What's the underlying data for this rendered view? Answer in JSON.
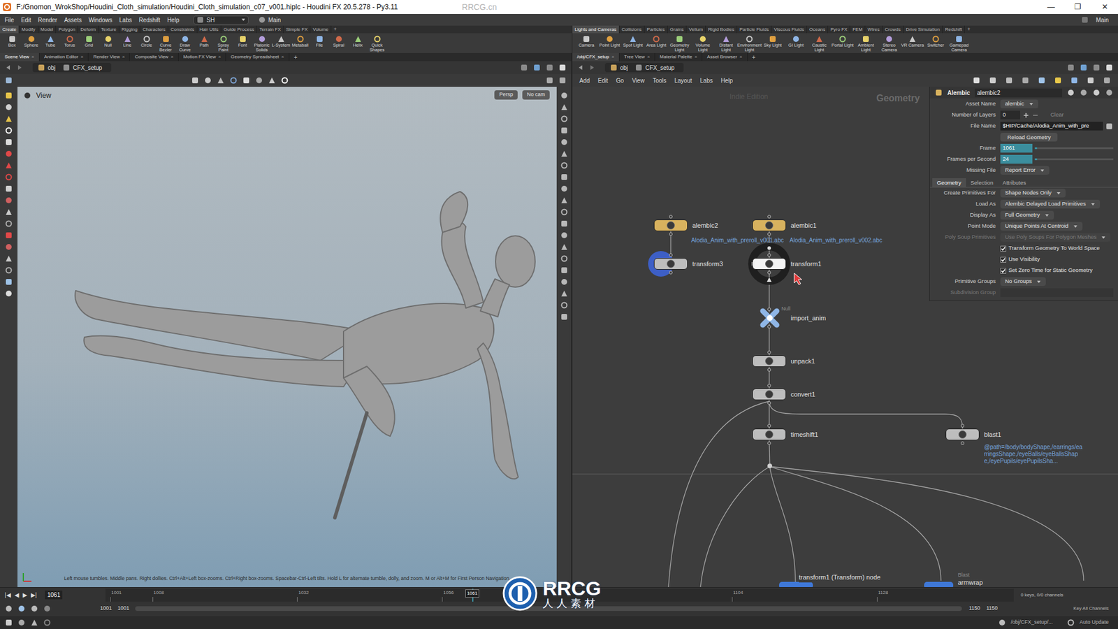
{
  "window": {
    "title": "F:/Gnomon_WrokShop/Houdini_Cloth_simulation/Houdini_Cloth_simulation_c07_v001.hiplc - Houdini FX 20.5.278 - Py3.11",
    "watermark": "RRCG.cn",
    "controls": [
      "—",
      "❐",
      "✕"
    ]
  },
  "menu": [
    "File",
    "Edit",
    "Render",
    "Assets",
    "Windows",
    "Labs",
    "Redshift",
    "Help"
  ],
  "desktop": {
    "value": "SH",
    "main": "Main",
    "main_right": "Main"
  },
  "ui": {
    "close": "×",
    "add": "+"
  },
  "shelf": {
    "tabs_left": [
      {
        "label": "Create",
        "selected": true
      },
      {
        "label": "Modify",
        "selected": false
      },
      {
        "label": "Model",
        "selected": false
      },
      {
        "label": "Polygon",
        "selected": false
      },
      {
        "label": "Deform",
        "selected": false
      },
      {
        "label": "Texture",
        "selected": false
      },
      {
        "label": "Rigging",
        "selected": false
      },
      {
        "label": "Characters",
        "selected": false
      },
      {
        "label": "Constraints",
        "selected": false
      },
      {
        "label": "Hair Utils",
        "selected": false
      },
      {
        "label": "Guide Process",
        "selected": false
      },
      {
        "label": "Terrain FX",
        "selected": false
      },
      {
        "label": "Simple FX",
        "selected": false
      },
      {
        "label": "Volume",
        "selected": false
      }
    ],
    "tabs_right": [
      {
        "label": "Lights and Cameras",
        "selected": true
      },
      {
        "label": "Collisions",
        "selected": false
      },
      {
        "label": "Particles",
        "selected": false
      },
      {
        "label": "Grains",
        "selected": false
      },
      {
        "label": "Vellum",
        "selected": false
      },
      {
        "label": "Rigid Bodies",
        "selected": false
      },
      {
        "label": "Particle Fluids",
        "selected": false
      },
      {
        "label": "Viscous Fluids",
        "selected": false
      },
      {
        "label": "Oceans",
        "selected": false
      },
      {
        "label": "Pyro FX",
        "selected": false
      },
      {
        "label": "FEM",
        "selected": false
      },
      {
        "label": "Wires",
        "selected": false
      },
      {
        "label": "Crowds",
        "selected": false
      },
      {
        "label": "Drive Simulation",
        "selected": false
      },
      {
        "label": "Redshift",
        "selected": false
      }
    ],
    "tools_left": [
      "Box",
      "Sphere",
      "Tube",
      "Torus",
      "Grid",
      "Null",
      "Line",
      "Circle",
      "Curve Bezier",
      "Draw Curve",
      "Path",
      "Spray Paint",
      "Font",
      "Platonic Solids",
      "L-System",
      "Metaball",
      "File",
      "Spiral",
      "Helix",
      "Quick Shapes"
    ],
    "tools_right": [
      "Camera",
      "Point Light",
      "Spot Light",
      "Area Light",
      "Geometry Light",
      "Volume Light",
      "Distant Light",
      "Environment Light",
      "Sky Light",
      "GI Light",
      "Caustic Light",
      "Portal Light",
      "Ambient Light",
      "Stereo Camera",
      "VR Camera",
      "Switcher",
      "Gamepad Camera"
    ]
  },
  "panes": {
    "left_tabs": [
      {
        "label": "Scene View",
        "selected": true
      },
      {
        "label": "Animation Editor",
        "selected": false
      },
      {
        "label": "Render View",
        "selected": false
      },
      {
        "label": "Composite View",
        "selected": false
      },
      {
        "label": "Motion FX View",
        "selected": false
      },
      {
        "label": "Geometry Spreadsheet",
        "selected": false
      }
    ],
    "right_tabs": [
      {
        "label": "/obj/CFX_setup",
        "selected": true
      },
      {
        "label": "Tree View",
        "selected": false
      },
      {
        "label": "Material Palette",
        "selected": false
      },
      {
        "label": "Asset Browser",
        "selected": false
      }
    ],
    "left_path": [
      "obj",
      "CFX_setup"
    ],
    "right_path": [
      "obj",
      "CFX_setup"
    ]
  },
  "viewport": {
    "title": "View",
    "persp": "Persp",
    "cam": "No cam",
    "hint": "Left mouse tumbles. Middle pans. Right dollies. Ctrl+Alt+Left box-zooms. Ctrl+Right box-zooms. Spacebar-Ctrl-Left tilts. Hold L for alternate tumble, dolly, and zoom. M or Alt+M for First Person Navigation."
  },
  "network": {
    "menu": [
      "Add",
      "Edit",
      "Go",
      "View",
      "Tools",
      "Layout",
      "Labs",
      "Help"
    ],
    "edition": "Indie Edition",
    "context": "Geometry",
    "nodes": [
      {
        "name": "alembic2",
        "color": "#d8b25e",
        "selected": false,
        "display": false,
        "note": "Alodia_Anim_with_preroll_v001.abc"
      },
      {
        "name": "alembic1",
        "color": "#d8b25e",
        "selected": false,
        "display": false,
        "note": "Alodia_Anim_with_preroll_v002.abc"
      },
      {
        "name": "transform3",
        "color": "#bdbdbd",
        "selected": false,
        "display": true
      },
      {
        "name": "transform1",
        "color": "#f4f4f4",
        "selected": true,
        "display": false
      },
      {
        "name": "import_anim",
        "color": "#8fb6e6",
        "selected": false,
        "display": false,
        "type": "Null"
      },
      {
        "name": "unpack1",
        "color": "#bdbdbd",
        "selected": false,
        "display": false
      },
      {
        "name": "convert1",
        "color": "#bdbdbd",
        "selected": false,
        "display": false
      },
      {
        "name": "timeshift1",
        "color": "#bdbdbd",
        "selected": false,
        "display": false
      },
      {
        "name": "blast1",
        "color": "#bdbdbd",
        "selected": false,
        "display": false,
        "note": "@path=/body/bodyShape,/earrings/earringsShape,/eyeBalls/eyeBallsShape,/eyePupils/eyePupilsSha..."
      }
    ],
    "tooltip": "transform1 (Transform) node",
    "bottom": [
      {
        "name": "armwrap",
        "type": "Blast"
      }
    ]
  },
  "params": {
    "type": "Alembic",
    "node": "alembic2",
    "rows": [
      {
        "kind": "menu",
        "label": "Asset Name",
        "value": "alembic",
        "disabled": false
      },
      {
        "kind": "number",
        "label": "Number of Layers",
        "value": "0",
        "extra": "Clear",
        "disabled": false
      },
      {
        "kind": "file",
        "label": "File Name",
        "value": "$HIP/Cache/Alodia_Anim_with_pre",
        "disabled": false
      },
      {
        "kind": "button",
        "label": "",
        "value": "Reload Geometry",
        "disabled": false
      },
      {
        "kind": "slider",
        "label": "Frame",
        "value": "1061",
        "level": 0.03,
        "disabled": false
      },
      {
        "kind": "slider",
        "label": "Frames per Second",
        "value": "24",
        "level": 0.03,
        "disabled": false
      },
      {
        "kind": "menu",
        "label": "Missing File",
        "value": "Report Error",
        "disabled": false
      }
    ],
    "tabs": [
      {
        "label": "Geometry",
        "selected": true
      },
      {
        "label": "Selection",
        "selected": false
      },
      {
        "label": "Attributes",
        "selected": false
      }
    ],
    "geometry": [
      {
        "kind": "menu",
        "label": "Create Primitives For",
        "value": "Shape Nodes Only",
        "disabled": false
      },
      {
        "kind": "menu",
        "label": "Load As",
        "value": "Alembic Delayed Load Primitives",
        "disabled": false
      },
      {
        "kind": "menu",
        "label": "Display As",
        "value": "Full Geometry",
        "disabled": false
      },
      {
        "kind": "menu",
        "label": "Point Mode",
        "value": "Unique Points At Centroid",
        "disabled": false
      },
      {
        "kind": "menu",
        "label": "Poly Soup Primitives",
        "value": "Use Poly Soups For Polygon Meshes",
        "disabled": true
      },
      {
        "kind": "check",
        "label": "",
        "value": "Transform Geometry To World Space",
        "checked": true,
        "disabled": false
      },
      {
        "kind": "check",
        "label": "",
        "value": "Use Visibility",
        "checked": true,
        "disabled": false
      },
      {
        "kind": "check",
        "label": "",
        "value": "Set Zero Time for Static Geometry",
        "checked": true,
        "disabled": false
      },
      {
        "kind": "menu",
        "label": "Primitive Groups",
        "value": "No Groups",
        "disabled": false
      },
      {
        "kind": "text",
        "label": "Subdivision Group",
        "value": "",
        "disabled": true
      }
    ]
  },
  "timeline": {
    "controls": [
      "|◀",
      "◀",
      "▶",
      "▶|"
    ],
    "frame": "1061",
    "ticks": [
      "1001",
      "1008",
      "1032",
      "1056",
      "1104",
      "1128"
    ],
    "current": "1061",
    "start": "1001",
    "start_2": "1001",
    "end": "1150",
    "end_2": "1150",
    "keys": "0 keys, 0/0 channels",
    "key_all": "Key All Channels"
  },
  "status": {
    "path": "/obj/CFX_setup/...",
    "auto_update": "Auto Update"
  },
  "logo": {
    "text": "RRCG",
    "sub": "人人素材"
  }
}
